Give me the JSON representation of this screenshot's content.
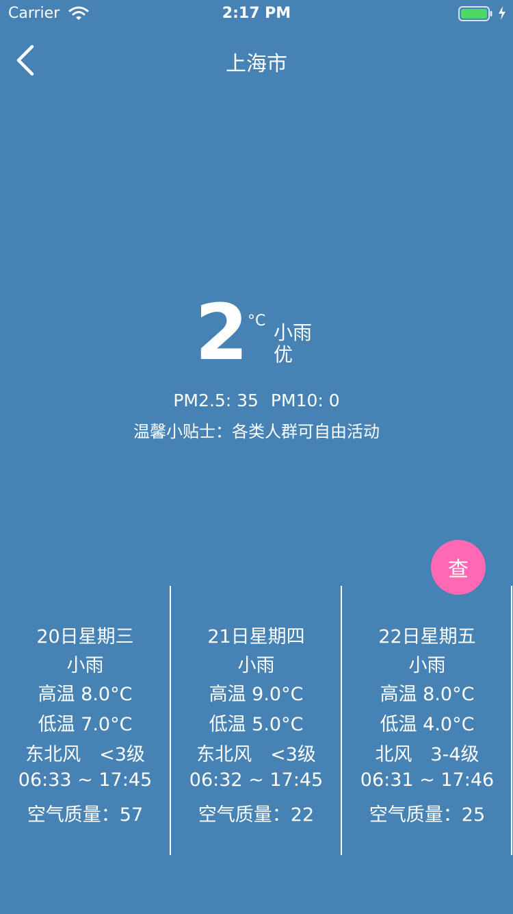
{
  "status_bar": {
    "carrier": "Carrier",
    "time": "2:17 PM",
    "wifi_icon": "wifi-icon",
    "battery_icon": "battery-icon",
    "battery_level": 1.0,
    "battery_color": "#4cd964"
  },
  "nav": {
    "back_icon": "chevron-left-icon",
    "title": "上海市"
  },
  "current": {
    "temperature": "2",
    "unit": "°C",
    "condition": "小雨",
    "aqi_level": "优",
    "pm25": "PM2.5: 35",
    "pm10": "PM10: 0",
    "tip": "温馨小贴士：各类人群可自由活动"
  },
  "query_button": {
    "label": "查",
    "color": "#ff69b4"
  },
  "forecast": [
    {
      "date": "20日星期三",
      "condition": "小雨",
      "high": "高温 8.0°C",
      "low": "低温 7.0°C",
      "wind": "东北风　<3级",
      "sun": "06:33 ~ 17:45",
      "aqi": "空气质量：57"
    },
    {
      "date": "21日星期四",
      "condition": "小雨",
      "high": "高温 9.0°C",
      "low": "低温 5.0°C",
      "wind": "东北风　<3级",
      "sun": "06:32 ~ 17:45",
      "aqi": "空气质量：22"
    },
    {
      "date": "22日星期五",
      "condition": "小雨",
      "high": "高温 8.0°C",
      "low": "低温 4.0°C",
      "wind": "北风　3-4级",
      "sun": "06:31 ~ 17:46",
      "aqi": "空气质量：25"
    }
  ],
  "colors": {
    "background": "#4682b4",
    "text": "#ffffff"
  }
}
